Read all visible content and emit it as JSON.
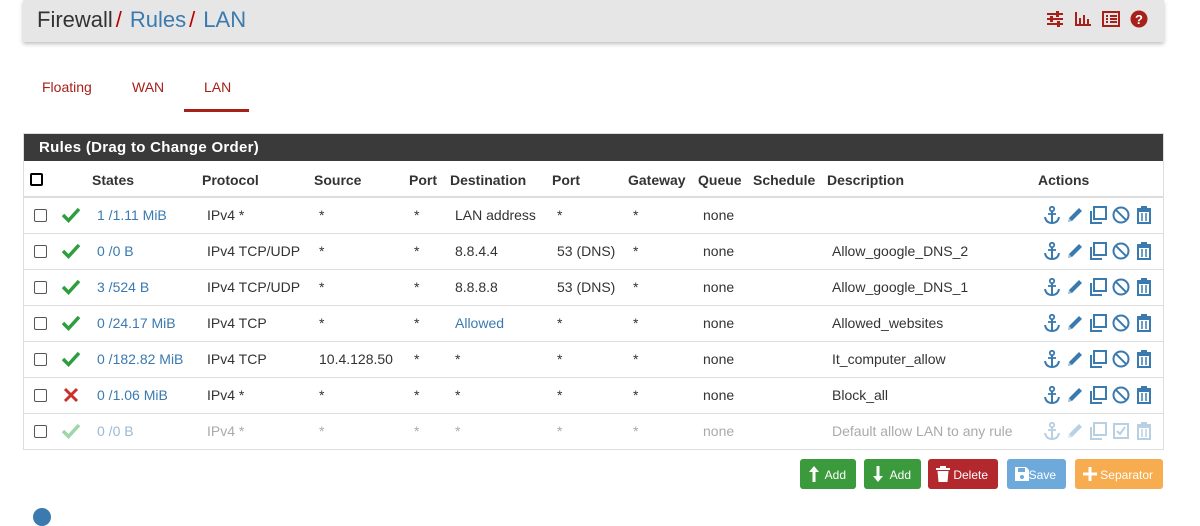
{
  "breadcrumb": {
    "root": "Firewall",
    "sep1": "/",
    "rules": "Rules",
    "sep2": "/",
    "current": "LAN"
  },
  "header_icons": [
    "sliders-icon",
    "bar-chart-icon",
    "list-icon",
    "help-icon"
  ],
  "tabs": [
    {
      "label": "Floating"
    },
    {
      "label": "WAN"
    },
    {
      "label": "LAN",
      "active": true
    }
  ],
  "panel_title": "Rules (Drag to Change Order)",
  "columns": [
    "States",
    "Protocol",
    "Source",
    "Port",
    "Destination",
    "Port",
    "Gateway",
    "Queue",
    "Schedule",
    "Description",
    "Actions"
  ],
  "rows": [
    {
      "status": "pass",
      "states": "1 /1.11 MiB",
      "protocol": "IPv4 *",
      "source": "*",
      "sport": "*",
      "dest": "LAN address",
      "dport": "*",
      "gateway": "*",
      "queue": "none",
      "schedule": "",
      "description": "",
      "disabled": false
    },
    {
      "status": "pass",
      "states": "0 /0 B",
      "protocol": "IPv4 TCP/UDP",
      "source": "*",
      "sport": "*",
      "dest": "8.8.4.4",
      "dport": "53 (DNS)",
      "gateway": "*",
      "queue": "none",
      "schedule": "",
      "description": "Allow_google_DNS_2",
      "disabled": false
    },
    {
      "status": "pass",
      "states": "3 /524 B",
      "protocol": "IPv4 TCP/UDP",
      "source": "*",
      "sport": "*",
      "dest": "8.8.8.8",
      "dport": "53 (DNS)",
      "gateway": "*",
      "queue": "none",
      "schedule": "",
      "description": "Allow_google_DNS_1",
      "disabled": false
    },
    {
      "status": "pass",
      "states": "0 /24.17 MiB",
      "protocol": "IPv4 TCP",
      "source": "*",
      "sport": "*",
      "dest": "Allowed",
      "dest_link": true,
      "dport": "*",
      "gateway": "*",
      "queue": "none",
      "schedule": "",
      "description": "Allowed_websites",
      "disabled": false
    },
    {
      "status": "pass",
      "states": "0 /182.82 MiB",
      "protocol": "IPv4 TCP",
      "source": "10.4.128.50",
      "sport": "*",
      "dest": "*",
      "dport": "*",
      "gateway": "*",
      "queue": "none",
      "schedule": "",
      "description": "It_computer_allow",
      "disabled": false
    },
    {
      "status": "block",
      "states": "0 /1.06 MiB",
      "protocol": "IPv4 *",
      "source": "*",
      "sport": "*",
      "dest": "*",
      "dport": "*",
      "gateway": "*",
      "queue": "none",
      "schedule": "",
      "description": "Block_all",
      "disabled": false
    },
    {
      "status": "pass",
      "states": "0 /0 B",
      "protocol": "IPv4 *",
      "source": "*",
      "sport": "*",
      "dest": "*",
      "dport": "*",
      "gateway": "*",
      "queue": "none",
      "schedule": "",
      "description": "Default allow LAN to any rule",
      "disabled": true
    }
  ],
  "buttons": {
    "add_top": "Add",
    "add_bottom": "Add",
    "delete": "Delete",
    "save": "Save",
    "separator": "Separator"
  },
  "colors": {
    "brand_red": "#a8201a",
    "link_blue": "#3a7aaf",
    "pass_green": "#2e9e3e",
    "block_red": "#c9302c",
    "btn_green": "#3b9a3b",
    "btn_red": "#b3282d",
    "btn_blue": "#6ea9dc",
    "btn_orange": "#f6ac4f"
  }
}
